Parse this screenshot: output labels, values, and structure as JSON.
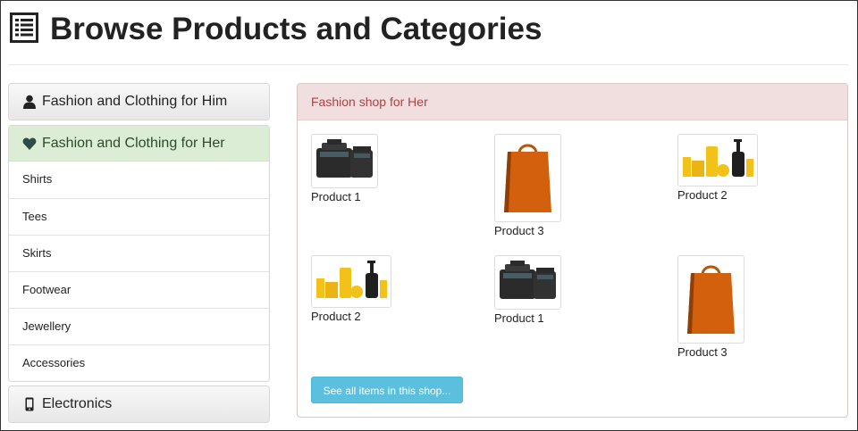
{
  "page": {
    "title": "Browse Products and Categories"
  },
  "sidebar": {
    "him": {
      "label": "Fashion and Clothing for Him",
      "icon": "user-icon"
    },
    "her": {
      "label": "Fashion and Clothing for Her",
      "icon": "heart-icon",
      "items": [
        "Shirts",
        "Tees",
        "Skirts",
        "Footwear",
        "Jewellery",
        "Accessories"
      ]
    },
    "electronics": {
      "label": "Electronics",
      "icon": "mobile-phone-icon"
    }
  },
  "shop": {
    "heading": "Fashion shop for Her",
    "products": [
      {
        "label": "Product 1",
        "image": "camera"
      },
      {
        "label": "Product 3",
        "image": "shopping-bag"
      },
      {
        "label": "Product 2",
        "image": "cosmetics"
      },
      {
        "label": "Product 2",
        "image": "cosmetics"
      },
      {
        "label": "Product 1",
        "image": "camera"
      },
      {
        "label": "Product 3",
        "image": "shopping-bag"
      }
    ],
    "see_all_label": "See all items in this shop..."
  },
  "colors": {
    "accent_button": "#5bc0de",
    "shop_heading_bg": "#f1dede",
    "shop_heading_text": "#a94442",
    "active_category_bg": "#dcedd5",
    "bag_orange": "#d2600d",
    "cosmetics_yellow": "#f2c21b"
  }
}
